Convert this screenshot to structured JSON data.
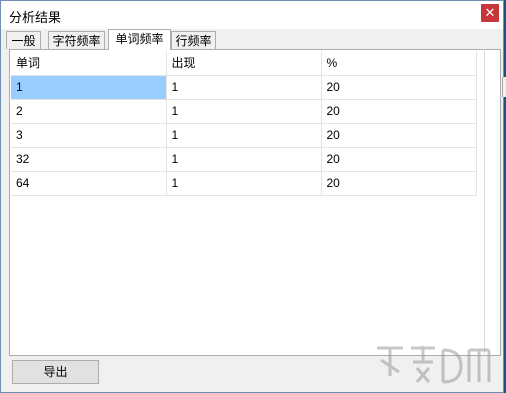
{
  "window": {
    "title": "分析结果"
  },
  "tabs": [
    {
      "label": "一般"
    },
    {
      "label": "字符频率"
    },
    {
      "label": "单词频率",
      "active": true
    },
    {
      "label": "行频率"
    }
  ],
  "table": {
    "headers": [
      "单词",
      "出现",
      "%"
    ],
    "rows": [
      [
        "1",
        "1",
        "20"
      ],
      [
        "2",
        "1",
        "20"
      ],
      [
        "3",
        "1",
        "20"
      ],
      [
        "32",
        "1",
        "20"
      ],
      [
        "64",
        "1",
        "20"
      ]
    ]
  },
  "buttons": {
    "export": "导出"
  },
  "colors": {
    "selection": "#99ccff",
    "close": "#c8353a"
  }
}
